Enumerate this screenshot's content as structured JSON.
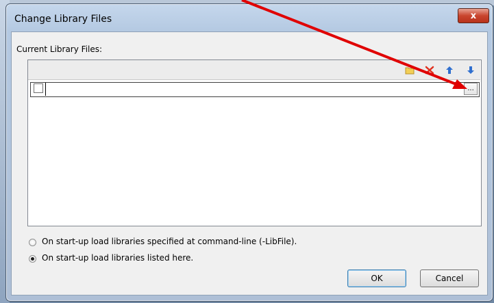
{
  "dialog": {
    "title": "Change Library Files",
    "close_label": "x",
    "group_label": "Current Library Files:",
    "toolbar": [
      "folder-icon",
      "delete-icon",
      "arrow-up-icon",
      "arrow-down-icon"
    ],
    "rows": [
      {
        "checked": false,
        "value": "",
        "browse_label": "..."
      }
    ],
    "options": [
      {
        "label": "On start-up load libraries specified at command-line (-LibFile).",
        "selected": false
      },
      {
        "label": "On start-up load libraries listed here.",
        "selected": true
      }
    ],
    "ok_label": "OK",
    "cancel_label": "Cancel"
  },
  "colors": {
    "accent": "#3c7fb1",
    "close": "#c9452e",
    "annotation_arrow": "#e00000"
  }
}
